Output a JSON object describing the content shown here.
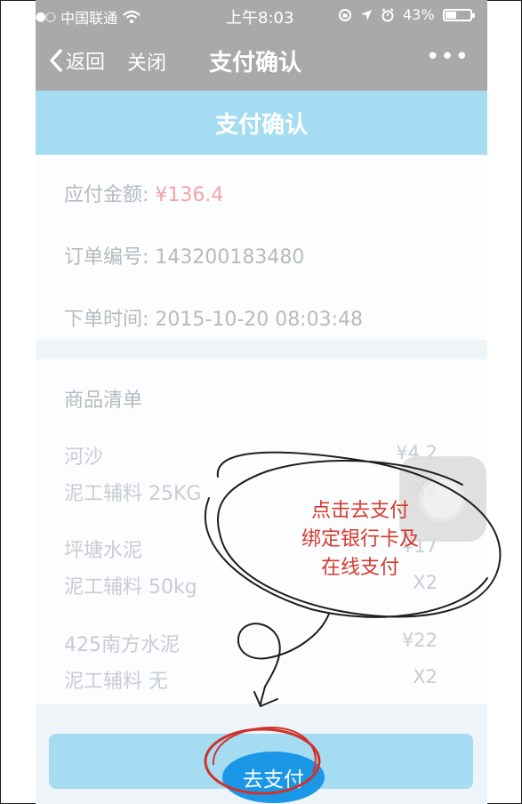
{
  "status_bar": {
    "carrier": "中国联通",
    "time": "上午8:03",
    "battery": "43%",
    "battery_level": 0.43
  },
  "nav": {
    "back_label": "返回",
    "close_label": "关闭",
    "title": "支付确认",
    "more_label": "•••"
  },
  "header": {
    "title": "支付确认"
  },
  "order": {
    "amount_label": "应付金额: ",
    "amount_value": "¥136.4",
    "order_no": "订单编号: 143200183480",
    "order_time": "下单时间: 2015-10-20 08:03:48"
  },
  "goods": {
    "title": "商品清单",
    "items": [
      {
        "name": "河沙",
        "sub": "泥工辅料 25KG",
        "price": "¥4.2",
        "qty": "X2"
      },
      {
        "name": "坪塘水泥",
        "sub": "泥工辅料 50kg",
        "price": "¥17",
        "qty": "X2"
      },
      {
        "name": "425南方水泥",
        "sub": "泥工辅料 无",
        "price": "¥22",
        "qty": "X2"
      }
    ]
  },
  "pay_button": {
    "label": "去支付"
  },
  "annotation": {
    "line1": "点击去支付",
    "line2": "绑定银行卡及",
    "line3": "在线支付"
  },
  "colors": {
    "nav_bg": "#a9a9a9",
    "header_bg": "#a6dcf1",
    "amount": "#f3a4a8",
    "pay_core": "#1a97e7",
    "annotation": "#d43a30"
  }
}
